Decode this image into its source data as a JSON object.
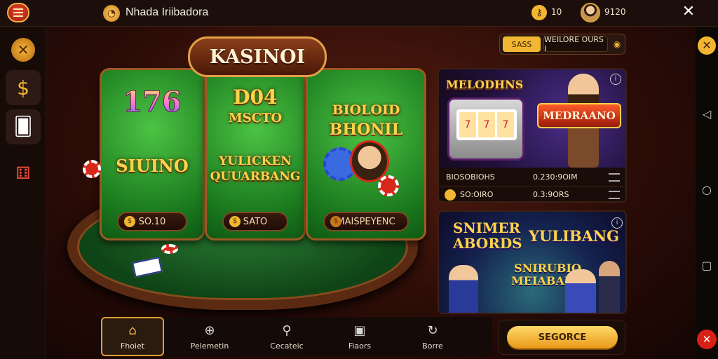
{
  "header": {
    "title": "Nhada Iriibadora",
    "key_count": "10",
    "coin_count": "9120"
  },
  "left_rail": {
    "items": [
      {
        "icon": "tools-icon"
      },
      {
        "icon": "coins-icon"
      },
      {
        "icon": "cards-icon"
      },
      {
        "icon": "dice-icon"
      }
    ]
  },
  "main": {
    "sign": "KASINOI",
    "panels": [
      {
        "top_text": "176",
        "sub_text": "SIUINO",
        "button_label": "SO.10"
      },
      {
        "top_text": "D04",
        "top_text2": "MSCTO",
        "sub_text": "YULICKEN",
        "sub_text2": "QUUARBANG",
        "button_label": "SATO"
      },
      {
        "top_text": "BIOLOID",
        "top_text2": "BHONIL",
        "button_label": "MAISPEYENC"
      }
    ]
  },
  "sort": {
    "label": "SASS",
    "value": "WEILORE OURS I"
  },
  "promo_card_1": {
    "title": "MELODHNS",
    "badge": "MEDRAANO",
    "rows": [
      {
        "col_a": "BIOSOBIOHS",
        "col_b": "0.230:9OIM"
      },
      {
        "col_a": "SO:OIRO",
        "col_b": "0.3:9ORS"
      }
    ]
  },
  "promo_card_2": {
    "title_left": "SNIMER ABORDS",
    "title_right": "YULIBANG",
    "center_text": "SNIRUBIO MEIABANG"
  },
  "bottom_nav": {
    "items": [
      {
        "label": "Fhoiet",
        "icon": "home-icon"
      },
      {
        "label": "Pelemetin",
        "icon": "compass-icon"
      },
      {
        "label": "Cecateic",
        "icon": "search-icon"
      },
      {
        "label": "Fiaors",
        "icon": "square-icon"
      },
      {
        "label": "Borre",
        "icon": "refresh-icon"
      }
    ]
  },
  "cta": {
    "label": "SEGORCE"
  }
}
